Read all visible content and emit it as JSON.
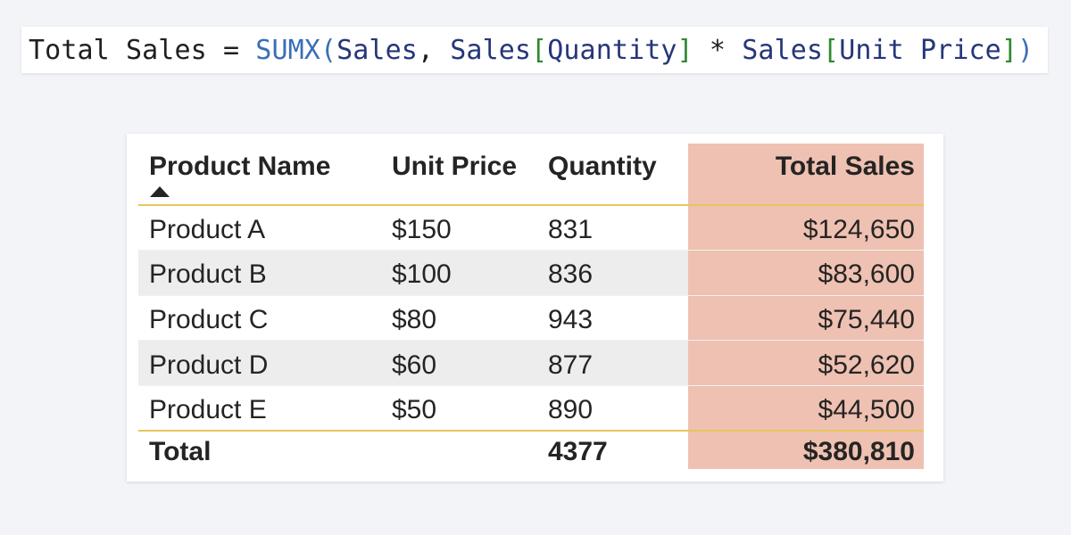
{
  "formula": {
    "measure_name": "Total Sales",
    "equals": " = ",
    "function": "SUMX",
    "open_paren": "(",
    "table": "Sales",
    "comma": ", ",
    "table2": "Sales",
    "open_bracket1": "[",
    "column1": "Quantity",
    "close_bracket1": "]",
    "operator": " * ",
    "table3": "Sales",
    "open_bracket2": "[",
    "column2": "Unit Price",
    "close_bracket2": "]",
    "close_paren": ")"
  },
  "table": {
    "headers": {
      "product_name": "Product Name",
      "unit_price": "Unit Price",
      "quantity": "Quantity",
      "total_sales": "Total Sales"
    },
    "sort": {
      "column": "Product Name",
      "direction": "ascending",
      "icon": "sort-ascending-icon"
    },
    "rows": [
      {
        "product_name": "Product A",
        "unit_price": "$150",
        "quantity": "831",
        "total_sales": "$124,650"
      },
      {
        "product_name": "Product B",
        "unit_price": "$100",
        "quantity": "836",
        "total_sales": "$83,600"
      },
      {
        "product_name": "Product C",
        "unit_price": "$80",
        "quantity": "943",
        "total_sales": "$75,440"
      },
      {
        "product_name": "Product D",
        "unit_price": "$60",
        "quantity": "877",
        "total_sales": "$52,620"
      },
      {
        "product_name": "Product E",
        "unit_price": "$50",
        "quantity": "890",
        "total_sales": "$44,500"
      }
    ],
    "total": {
      "label": "Total",
      "unit_price": "",
      "quantity": "4377",
      "total_sales": "$380,810"
    }
  },
  "colors": {
    "background": "#f3f4f8",
    "highlight_column": "#eec1b2",
    "banded_row": "#ededed",
    "rule": "#e8c65a",
    "dax_function": "#3a6fb6",
    "dax_reference": "#26367a",
    "dax_bracket": "#2f8a2f"
  }
}
